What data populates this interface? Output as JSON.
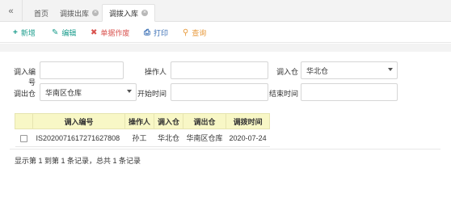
{
  "tabs": {
    "collapse_icon": "double-chevron-left-icon",
    "items": [
      {
        "label": "首页"
      },
      {
        "label": "调拨出库"
      },
      {
        "label": "调拨入库"
      }
    ]
  },
  "toolbar": {
    "add": "新增",
    "edit": "编辑",
    "void": "单据作废",
    "print": "打印",
    "query": "查询"
  },
  "filters": {
    "in_no_label": "调入编号",
    "in_no_value": "",
    "operator_label": "操作人",
    "operator_value": "",
    "in_wh_label": "调入仓",
    "in_wh_value": "华北仓",
    "out_wh_label": "调出仓",
    "out_wh_value": "华南区仓库",
    "start_label": "开始时间",
    "start_value": "",
    "end_label": "结束时间",
    "end_value": ""
  },
  "table": {
    "headers": [
      "调入编号",
      "操作人",
      "调入仓",
      "调出仓",
      "调拨时间"
    ],
    "rows": [
      [
        "IS2020071617271627808",
        "孙工",
        "华北仓",
        "华南区仓库",
        "2020-07-24"
      ]
    ]
  },
  "footer": "显示第 1 到第 1 条记录，总共 1 条记录",
  "colors": {
    "add": "#1a9c8c",
    "edit": "#1a9c8c",
    "void": "#d9534f",
    "print": "#3a6fb5",
    "query": "#e89a3c",
    "header_bg": "#f8f7c6"
  }
}
